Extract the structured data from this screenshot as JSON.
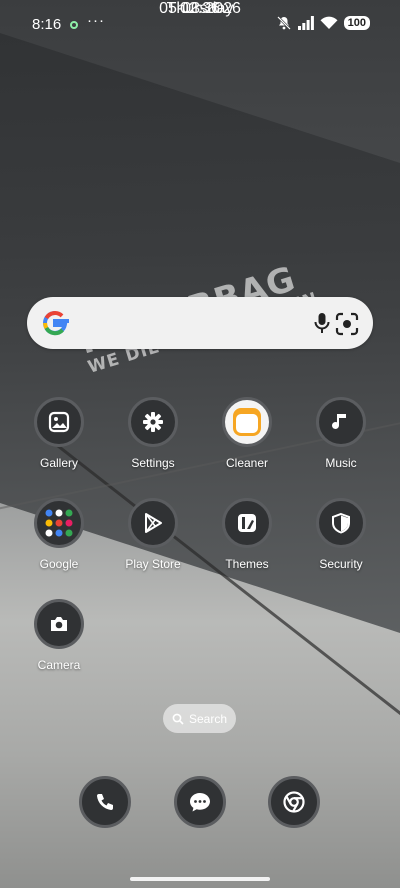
{
  "status_bar": {
    "time": "8:16",
    "more": "···",
    "battery": "100",
    "icons": [
      "mute-icon",
      "signal-icon",
      "wifi-icon",
      "battery-icon"
    ]
  },
  "clock": {
    "time": "02:36",
    "date": "05-03-2026",
    "day": "Thursday"
  },
  "wallpaper": {
    "sticker_line1": "NO AIRBAG",
    "sticker_line2": "WE DIE LIKE REAL MEN"
  },
  "search_bar": {
    "icons": [
      "google-icon",
      "mic-icon",
      "lens-icon"
    ]
  },
  "apps": [
    {
      "label": "Gallery",
      "icon": "gallery-icon"
    },
    {
      "label": "Settings",
      "icon": "gear-icon"
    },
    {
      "label": "Cleaner",
      "icon": "cleaner-icon"
    },
    {
      "label": "Music",
      "icon": "music-icon"
    },
    {
      "label": "Google",
      "icon": "google-folder-icon"
    },
    {
      "label": "Play Store",
      "icon": "play-store-icon"
    },
    {
      "label": "Themes",
      "icon": "themes-icon"
    },
    {
      "label": "Security",
      "icon": "shield-icon"
    },
    {
      "label": "Camera",
      "icon": "camera-icon"
    }
  ],
  "app_search": {
    "label": "Search"
  },
  "dock": [
    {
      "icon": "phone-icon"
    },
    {
      "icon": "messages-icon"
    },
    {
      "icon": "chrome-icon"
    }
  ],
  "colors": {
    "icon_bg": "#303234",
    "icon_ring": "#5b5d60",
    "cleaner_accent": "#f6a623",
    "status_dot": "#8ef0a8"
  }
}
